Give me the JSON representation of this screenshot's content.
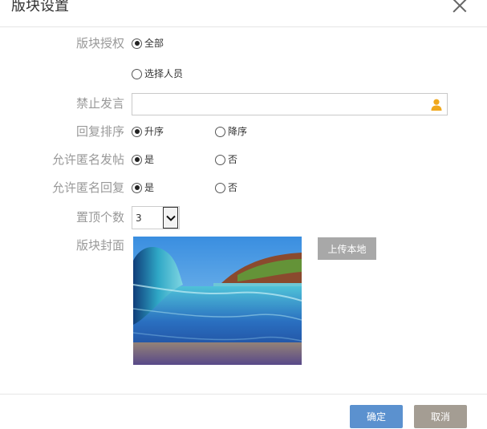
{
  "dialog": {
    "title": "版块设置",
    "close_icon": "close-icon"
  },
  "form": {
    "auth": {
      "label": "版块授权",
      "options": [
        {
          "label": "全部",
          "checked": true
        },
        {
          "label": "选择人员",
          "checked": false
        }
      ]
    },
    "mute": {
      "label": "禁止发言",
      "value": "",
      "icon": "person-icon"
    },
    "sort": {
      "label": "回复排序",
      "options": [
        {
          "label": "升序",
          "checked": true
        },
        {
          "label": "降序",
          "checked": false
        }
      ]
    },
    "anon_post": {
      "label": "允许匿名发帖",
      "options": [
        {
          "label": "是",
          "checked": true
        },
        {
          "label": "否",
          "checked": false
        }
      ]
    },
    "anon_reply": {
      "label": "允许匿名回复",
      "options": [
        {
          "label": "是",
          "checked": true
        },
        {
          "label": "否",
          "checked": false
        }
      ]
    },
    "top_count": {
      "label": "置顶个数",
      "value": "3"
    },
    "cover": {
      "label": "版块封面",
      "upload_label": "上传本地"
    }
  },
  "footer": {
    "ok_label": "确定",
    "cancel_label": "取消"
  },
  "colors": {
    "primary": "#5b91cf",
    "cancel": "#a49d93",
    "upload": "#a8a8a8",
    "label": "#999999"
  }
}
